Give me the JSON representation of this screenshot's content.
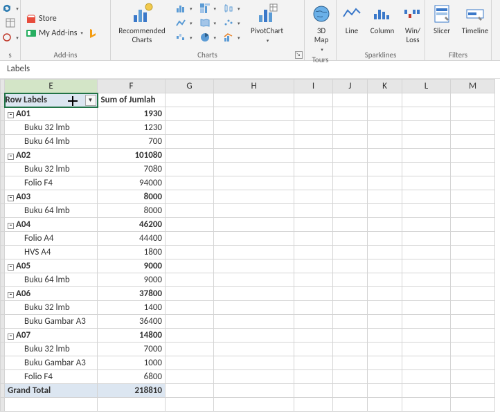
{
  "ribbon": {
    "addins": {
      "store": "Store",
      "myaddins": "My Add-ins",
      "label": "Add-ins"
    },
    "charts": {
      "recommended1": "Recommended",
      "recommended2": "Charts",
      "pivot1": "PivotChart",
      "label": "Charts"
    },
    "tours": {
      "map1": "3D",
      "map2": "Map",
      "label": "Tours"
    },
    "sparklines": {
      "line": "Line",
      "column": "Column",
      "winloss1": "Win/",
      "winloss2": "Loss",
      "label": "Sparklines"
    },
    "filters": {
      "slicer": "Slicer",
      "timeline": "Timeline",
      "label": "Filters"
    }
  },
  "namebox": "Labels",
  "columns": [
    "E",
    "F",
    "G",
    "H",
    "I",
    "J",
    "K",
    "L",
    "M"
  ],
  "pivot": {
    "header_rowlabels": "Row Labels",
    "header_value": "Sum of Jumlah",
    "groups": [
      {
        "key": "A01",
        "total": 1930,
        "rows": [
          {
            "n": "Buku 32 lmb",
            "v": 1230
          },
          {
            "n": "Buku 64 lmb",
            "v": 700
          }
        ]
      },
      {
        "key": "A02",
        "total": 101080,
        "rows": [
          {
            "n": "Buku 32 lmb",
            "v": 7080
          },
          {
            "n": "Folio F4",
            "v": 94000
          }
        ]
      },
      {
        "key": "A03",
        "total": 8000,
        "rows": [
          {
            "n": "Buku 64 lmb",
            "v": 8000
          }
        ]
      },
      {
        "key": "A04",
        "total": 46200,
        "rows": [
          {
            "n": "Folio A4",
            "v": 44400
          },
          {
            "n": "HVS A4",
            "v": 1800
          }
        ]
      },
      {
        "key": "A05",
        "total": 9000,
        "rows": [
          {
            "n": "Buku 64 lmb",
            "v": 9000
          }
        ]
      },
      {
        "key": "A06",
        "total": 37800,
        "rows": [
          {
            "n": "Buku 32 lmb",
            "v": 1400
          },
          {
            "n": "Buku Gambar A3",
            "v": 36400
          }
        ]
      },
      {
        "key": "A07",
        "total": 14800,
        "rows": [
          {
            "n": "Buku 32 lmb",
            "v": 7000
          },
          {
            "n": "Buku Gambar A3",
            "v": 1000
          },
          {
            "n": "Folio F4",
            "v": 6800
          }
        ]
      }
    ],
    "grand_label": "Grand Total",
    "grand_total": 218810
  },
  "chart_data": {
    "type": "table",
    "title": "PivotTable Sum of Jumlah by Row Labels",
    "columns": [
      "Row Labels",
      "Sum of Jumlah"
    ],
    "rows": [
      [
        "A01",
        1930
      ],
      [
        "  Buku 32 lmb",
        1230
      ],
      [
        "  Buku 64 lmb",
        700
      ],
      [
        "A02",
        101080
      ],
      [
        "  Buku 32 lmb",
        7080
      ],
      [
        "  Folio F4",
        94000
      ],
      [
        "A03",
        8000
      ],
      [
        "  Buku 64 lmb",
        8000
      ],
      [
        "A04",
        46200
      ],
      [
        "  Folio A4",
        44400
      ],
      [
        "  HVS A4",
        1800
      ],
      [
        "A05",
        9000
      ],
      [
        "  Buku 64 lmb",
        9000
      ],
      [
        "A06",
        37800
      ],
      [
        "  Buku 32 lmb",
        1400
      ],
      [
        "  Buku Gambar A3",
        36400
      ],
      [
        "A07",
        14800
      ],
      [
        "  Buku 32 lmb",
        7000
      ],
      [
        "  Buku Gambar A3",
        1000
      ],
      [
        "  Folio F4",
        6800
      ],
      [
        "Grand Total",
        218810
      ]
    ]
  }
}
